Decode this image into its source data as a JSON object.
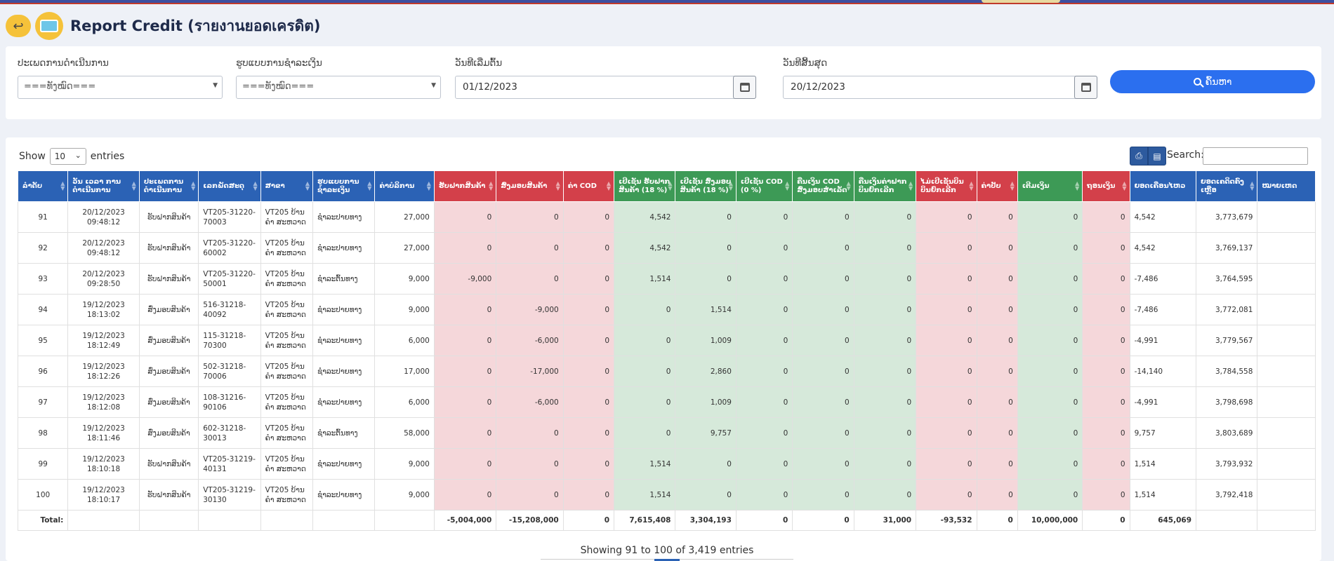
{
  "page": {
    "title": "Report Credit (รายงานยอดเครดิต)"
  },
  "filters": {
    "type_label": "ປະເພດການດຳເນີນການ",
    "type_value": "===ທັງໝົດ===",
    "payment_label": "ຮູບແບບການຊຳລະເງິນ",
    "payment_value": "===ທັງໝົດ===",
    "start_label": "ວັນທີເລີ່ມຕົ້ນ",
    "start_value": "01/12/2023",
    "end_label": "ວັນທີສິ້ນສຸດ",
    "end_value": "20/12/2023",
    "search_button": "ຄົ້ນຫາ"
  },
  "table_controls": {
    "show": "Show",
    "length": "10",
    "entries": "entries",
    "search_label": "Search:",
    "print_icon": "print-icon",
    "export_icon": "export-icon"
  },
  "columns": [
    {
      "label": "ລຳດັບ",
      "color": "#2b62b5"
    },
    {
      "label": "ວັນ ເວລາ ການ ດຳເນີນການ",
      "color": "#2b62b5"
    },
    {
      "label": "ປະເພດການ ດຳເນີນການ",
      "color": "#2b62b5"
    },
    {
      "label": "ເລກພັດສະດຸ",
      "color": "#2b62b5"
    },
    {
      "label": "ສາຂາ",
      "color": "#2b62b5"
    },
    {
      "label": "ຮູບແບບການ ຊຳລະເງິນ",
      "color": "#2b62b5"
    },
    {
      "label": "ຄ່າບໍລິການ",
      "color": "#2b62b5"
    },
    {
      "label": "ຮັບຝາກສິນຄ້າ",
      "color": "#d3404a"
    },
    {
      "label": "ສົ່ງມອບສິນຄ້າ",
      "color": "#d3404a"
    },
    {
      "label": "ຄ່າ COD",
      "color": "#d3404a"
    },
    {
      "label": "ເປີເຊັນ ຮັບຝາກ ສິນຄ້າ (18 %)",
      "color": "#3d9a56"
    },
    {
      "label": "ເປີເຊັນ ສົ່ງມອບ ສິນຄ້າ (18 %)",
      "color": "#3d9a56"
    },
    {
      "label": "ເປີເຊັນ COD (0 %)",
      "color": "#3d9a56"
    },
    {
      "label": "ຄືນເງິນ COD ສົ່ງມອບສຳເລັດ",
      "color": "#3d9a56"
    },
    {
      "label": "ຄືນເງິນຄ່າຝາກ ບິນຍົກເລີກ",
      "color": "#3d9a56"
    },
    {
      "label": "ໄມ່ເປີເຊັນບິນ ບິນຍົກເລີກ",
      "color": "#d3404a"
    },
    {
      "label": "ຄ່າປັບ",
      "color": "#d3404a"
    },
    {
      "label": "ເຕີມເງິນ",
      "color": "#3d9a56"
    },
    {
      "label": "ຖອນເງິນ",
      "color": "#d3404a"
    },
    {
      "label": "ຍອດເຄື່ອນໄຫວ",
      "color": "#2b62b5"
    },
    {
      "label": "ຍອດເຄດິດຄົງ ເຫຼືອ",
      "color": "#2b62b5"
    },
    {
      "label": "ໝາຍເຫດ",
      "color": "#2b62b5"
    }
  ],
  "rows": [
    [
      "91",
      "20/12/2023 09:48:12",
      "ຮັບຝາກສິນຄ້າ",
      "VT205-31220-70003",
      "VT205 ບ້ານຄຳ ສະຫວາດ",
      "ຊຳລະປາຍທາງ",
      "27,000",
      "0",
      "0",
      "0",
      "4,542",
      "0",
      "0",
      "0",
      "0",
      "0",
      "0",
      "0",
      "0",
      "4,542",
      "3,773,679",
      ""
    ],
    [
      "92",
      "20/12/2023 09:48:12",
      "ຮັບຝາກສິນຄ້າ",
      "VT205-31220-60002",
      "VT205 ບ້ານຄຳ ສະຫວາດ",
      "ຊຳລະປາຍທາງ",
      "27,000",
      "0",
      "0",
      "0",
      "4,542",
      "0",
      "0",
      "0",
      "0",
      "0",
      "0",
      "0",
      "0",
      "4,542",
      "3,769,137",
      ""
    ],
    [
      "93",
      "20/12/2023 09:28:50",
      "ຮັບຝາກສິນຄ້າ",
      "VT205-31220-50001",
      "VT205 ບ້ານຄຳ ສະຫວາດ",
      "ຊຳລະຕົ້ນທາງ",
      "9,000",
      "-9,000",
      "0",
      "0",
      "1,514",
      "0",
      "0",
      "0",
      "0",
      "0",
      "0",
      "0",
      "0",
      "-7,486",
      "3,764,595",
      ""
    ],
    [
      "94",
      "19/12/2023 18:13:02",
      "ສົ່ງມອບສິນຄ້າ",
      "516-31218-40092",
      "VT205 ບ້ານຄຳ ສະຫວາດ",
      "ຊຳລະປາຍທາງ",
      "9,000",
      "0",
      "-9,000",
      "0",
      "0",
      "1,514",
      "0",
      "0",
      "0",
      "0",
      "0",
      "0",
      "0",
      "-7,486",
      "3,772,081",
      ""
    ],
    [
      "95",
      "19/12/2023 18:12:49",
      "ສົ່ງມອບສິນຄ້າ",
      "115-31218-70300",
      "VT205 ບ້ານຄຳ ສະຫວາດ",
      "ຊຳລະປາຍທາງ",
      "6,000",
      "0",
      "-6,000",
      "0",
      "0",
      "1,009",
      "0",
      "0",
      "0",
      "0",
      "0",
      "0",
      "0",
      "-4,991",
      "3,779,567",
      ""
    ],
    [
      "96",
      "19/12/2023 18:12:26",
      "ສົ່ງມອບສິນຄ້າ",
      "502-31218-70006",
      "VT205 ບ້ານຄຳ ສະຫວາດ",
      "ຊຳລະປາຍທາງ",
      "17,000",
      "0",
      "-17,000",
      "0",
      "0",
      "2,860",
      "0",
      "0",
      "0",
      "0",
      "0",
      "0",
      "0",
      "-14,140",
      "3,784,558",
      ""
    ],
    [
      "97",
      "19/12/2023 18:12:08",
      "ສົ່ງມອບສິນຄ້າ",
      "108-31216-90106",
      "VT205 ບ້ານຄຳ ສະຫວາດ",
      "ຊຳລະປາຍທາງ",
      "6,000",
      "0",
      "-6,000",
      "0",
      "0",
      "1,009",
      "0",
      "0",
      "0",
      "0",
      "0",
      "0",
      "0",
      "-4,991",
      "3,798,698",
      ""
    ],
    [
      "98",
      "19/12/2023 18:11:46",
      "ສົ່ງມອບສິນຄ້າ",
      "602-31218-30013",
      "VT205 ບ້ານຄຳ ສະຫວາດ",
      "ຊຳລະຕົ້ນທາງ",
      "58,000",
      "0",
      "0",
      "0",
      "0",
      "9,757",
      "0",
      "0",
      "0",
      "0",
      "0",
      "0",
      "0",
      "9,757",
      "3,803,689",
      ""
    ],
    [
      "99",
      "19/12/2023 18:10:18",
      "ຮັບຝາກສິນຄ້າ",
      "VT205-31219-40131",
      "VT205 ບ້ານຄຳ ສະຫວາດ",
      "ຊຳລະປາຍທາງ",
      "9,000",
      "0",
      "0",
      "0",
      "1,514",
      "0",
      "0",
      "0",
      "0",
      "0",
      "0",
      "0",
      "0",
      "1,514",
      "3,793,932",
      ""
    ],
    [
      "100",
      "19/12/2023 18:10:17",
      "ຮັບຝາກສິນຄ້າ",
      "VT205-31219-30130",
      "VT205 ບ້ານຄຳ ສະຫວາດ",
      "ຊຳລະປາຍທາງ",
      "9,000",
      "0",
      "0",
      "0",
      "1,514",
      "0",
      "0",
      "0",
      "0",
      "0",
      "0",
      "0",
      "0",
      "1,514",
      "3,792,418",
      ""
    ]
  ],
  "totals": {
    "label": "Total:",
    "values": [
      "",
      "",
      "",
      "",
      "",
      "",
      "-5,004,000",
      "-15,208,000",
      "0",
      "7,615,408",
      "3,304,193",
      "0",
      "0",
      "31,000",
      "-93,532",
      "0",
      "10,000,000",
      "0",
      "645,069",
      "",
      ""
    ]
  },
  "footer": {
    "info": "Showing 91 to 100 of 3,419 entries"
  }
}
